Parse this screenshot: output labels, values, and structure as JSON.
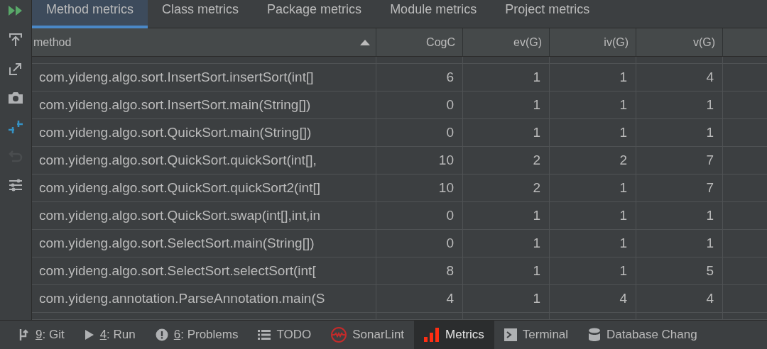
{
  "tabs": [
    {
      "label": "Method metrics",
      "selected": true
    },
    {
      "label": "Class metrics",
      "selected": false
    },
    {
      "label": "Package metrics",
      "selected": false
    },
    {
      "label": "Module metrics",
      "selected": false
    },
    {
      "label": "Project metrics",
      "selected": false
    }
  ],
  "toolbar": [
    {
      "kind": "run",
      "disabled": false
    },
    {
      "kind": "upload",
      "disabled": false
    },
    {
      "kind": "export",
      "disabled": false
    },
    {
      "kind": "camera",
      "disabled": false
    },
    {
      "kind": "compare",
      "disabled": false
    },
    {
      "kind": "undo",
      "disabled": true
    },
    {
      "kind": "sliders",
      "disabled": false
    }
  ],
  "table": {
    "columns": [
      "method",
      "CogC",
      "ev(G)",
      "iv(G)",
      "v(G)"
    ],
    "rows": [
      [
        "com.yideng.algo.sort.InsertSort.insertSort(int[]",
        "6",
        "1",
        "1",
        "4"
      ],
      [
        "com.yideng.algo.sort.InsertSort.main(String[])",
        "0",
        "1",
        "1",
        "1"
      ],
      [
        "com.yideng.algo.sort.QuickSort.main(String[])",
        "0",
        "1",
        "1",
        "1"
      ],
      [
        "com.yideng.algo.sort.QuickSort.quickSort(int[],",
        "10",
        "2",
        "2",
        "7"
      ],
      [
        "com.yideng.algo.sort.QuickSort.quickSort2(int[]",
        "10",
        "2",
        "1",
        "7"
      ],
      [
        "com.yideng.algo.sort.QuickSort.swap(int[],int,in",
        "0",
        "1",
        "1",
        "1"
      ],
      [
        "com.yideng.algo.sort.SelectSort.main(String[])",
        "0",
        "1",
        "1",
        "1"
      ],
      [
        "com.yideng.algo.sort.SelectSort.selectSort(int[",
        "8",
        "1",
        "1",
        "5"
      ],
      [
        "com.yideng.annotation.ParseAnnotation.main(S",
        "4",
        "1",
        "4",
        "4"
      ]
    ]
  },
  "bottom_tabs": [
    {
      "kind": "git",
      "key": "9",
      "label": ": Git",
      "selected": false
    },
    {
      "kind": "run",
      "key": "4",
      "label": ": Run",
      "selected": false
    },
    {
      "kind": "problems",
      "key": "6",
      "label": ": Problems",
      "selected": false
    },
    {
      "kind": "todo",
      "label": "TODO",
      "selected": false
    },
    {
      "kind": "sonar",
      "label": "SonarLint",
      "selected": false
    },
    {
      "kind": "metrics",
      "label": "Metrics",
      "selected": true
    },
    {
      "kind": "terminal",
      "label": "Terminal",
      "selected": false
    },
    {
      "kind": "database",
      "label": "Database Chang",
      "selected": false
    }
  ]
}
